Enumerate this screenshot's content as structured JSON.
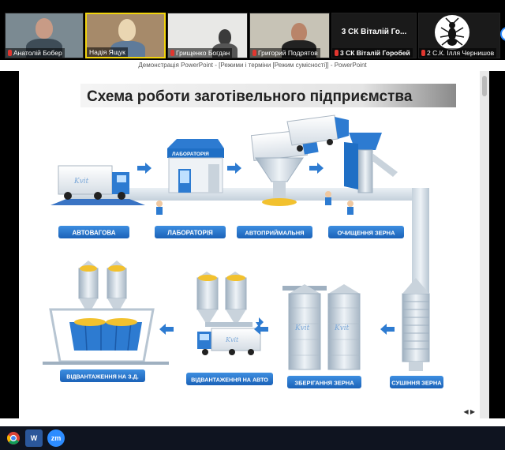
{
  "participants": [
    {
      "name": "Анатолій Бобер",
      "muted": true
    },
    {
      "name": "Надія Ящук",
      "muted": false
    },
    {
      "name": "Грищенко Богдан",
      "muted": true
    },
    {
      "name": "Григорий Подрятов",
      "muted": true
    },
    {
      "name": "3 СК Віталій Горобей",
      "display": "3 СК Віталій Го...",
      "muted": true
    },
    {
      "name": "2 С.К. Ілля Чернишов",
      "muted": true
    }
  ],
  "window_title": "Демонстрація PowerPoint - [Режими і терміни [Режим сумісності]] - PowerPoint",
  "slide": {
    "title": "Схема роботи заготівельного підприємства",
    "lab_sign": "ЛАБОРАТОРІЯ",
    "stations": [
      "АВТОВАГОВА",
      "ЛАБОРАТОРІЯ",
      "АВТОПРИЙМАЛЬНЯ",
      "ОЧИЩЕННЯ ЗЕРНА",
      "СУШІННЯ ЗЕРНА",
      "ЗБЕРІГАННЯ ЗЕРНА",
      "ВІДВАНТАЖЕННЯ НА АВТО",
      "ВІДВАНТАЖЕННЯ НА З.Д."
    ]
  },
  "colors": {
    "label_blue": "#1f6fc5",
    "machine_blue": "#2d7bd1",
    "grey_metal": "#c9d3dc",
    "grain": "#f2c12e",
    "active_border": "#f2d40c"
  },
  "taskbar": {
    "apps": [
      {
        "icon": "chrome-icon"
      },
      {
        "icon": "word-icon",
        "label": "W"
      },
      {
        "icon": "zoom-icon",
        "label": "zm"
      }
    ]
  }
}
